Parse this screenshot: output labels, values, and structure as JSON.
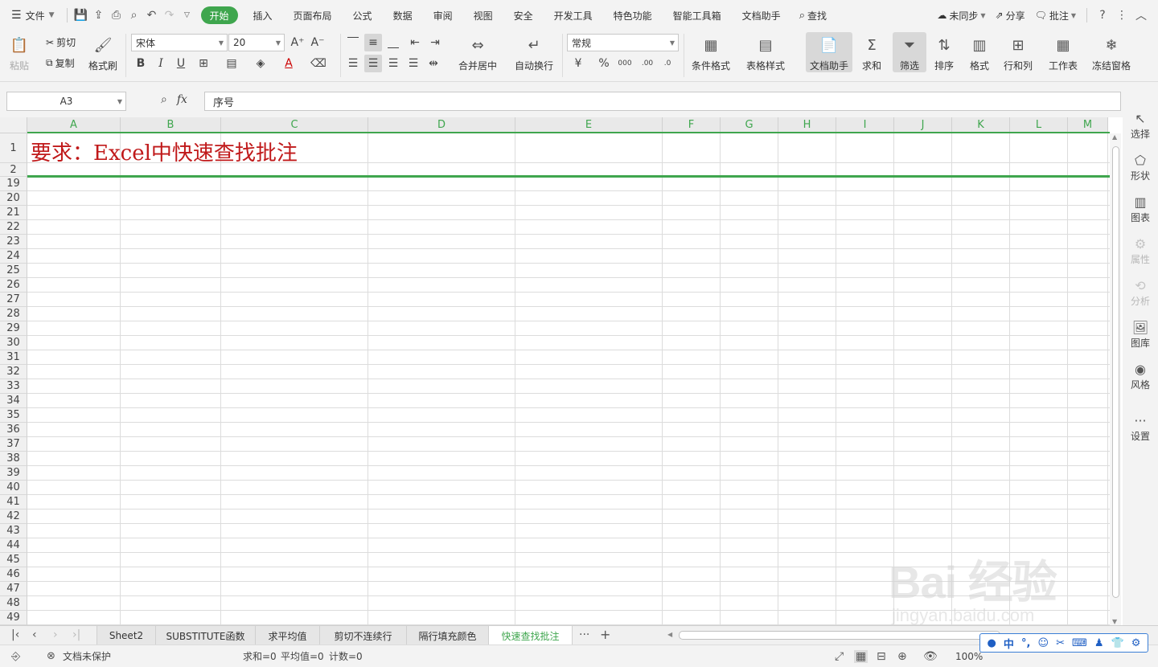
{
  "menubar": {
    "file_label": "文件",
    "tabs": [
      "开始",
      "插入",
      "页面布局",
      "公式",
      "数据",
      "审阅",
      "视图",
      "安全",
      "开发工具",
      "特色功能",
      "智能工具箱",
      "文档助手"
    ],
    "search_label": "查找",
    "sync_label": "未同步",
    "share_label": "分享",
    "comment_label": "批注"
  },
  "ribbon": {
    "paste": "粘贴",
    "cut": "剪切",
    "copy": "复制",
    "format_painter": "格式刷",
    "font_name": "宋体",
    "font_size": "20",
    "merge_center": "合并居中",
    "wrap_text": "自动换行",
    "number_format": "常规",
    "conditional_format": "条件格式",
    "table_style": "表格样式",
    "doc_assistant": "文档助手",
    "sum": "求和",
    "filter": "筛选",
    "sort": "排序",
    "format": "格式",
    "row_col": "行和列",
    "worksheet": "工作表",
    "freeze_panes": "冻结窗格"
  },
  "formula_bar": {
    "cell_ref": "A3",
    "fx_label": "fx",
    "content": "序号"
  },
  "grid": {
    "columns": [
      "A",
      "B",
      "C",
      "D",
      "E",
      "F",
      "G",
      "H",
      "I",
      "J",
      "K",
      "L",
      "M"
    ],
    "rows": [
      "1",
      "2",
      "19",
      "20",
      "21",
      "22",
      "23",
      "24",
      "25",
      "26",
      "27",
      "28",
      "29",
      "30",
      "31",
      "32",
      "33",
      "34",
      "35",
      "36",
      "37",
      "38",
      "39",
      "40",
      "41",
      "42",
      "43",
      "44",
      "45",
      "46",
      "47",
      "48",
      "49"
    ],
    "title_text": "要求：Excel中快速查找批注"
  },
  "right_panel": [
    "选择",
    "形状",
    "图表",
    "属性",
    "分析",
    "图库",
    "风格",
    "设置"
  ],
  "sheet_tabs": [
    "Sheet2",
    "SUBSTITUTE函数",
    "求平均值",
    "剪切不连续行",
    "隔行填充颜色",
    "快速查找批注"
  ],
  "status_bar": {
    "protection": "文档未保护",
    "sum": "求和=0",
    "average": "平均值=0",
    "count": "计数=0",
    "zoom": "100%"
  },
  "ime": {
    "lang": "中"
  },
  "watermark": {
    "big": "Bai 经验",
    "small": "jingyan.baidu.com"
  },
  "colors": {
    "accent": "#3fa64e",
    "title_red": "#c0191a"
  }
}
